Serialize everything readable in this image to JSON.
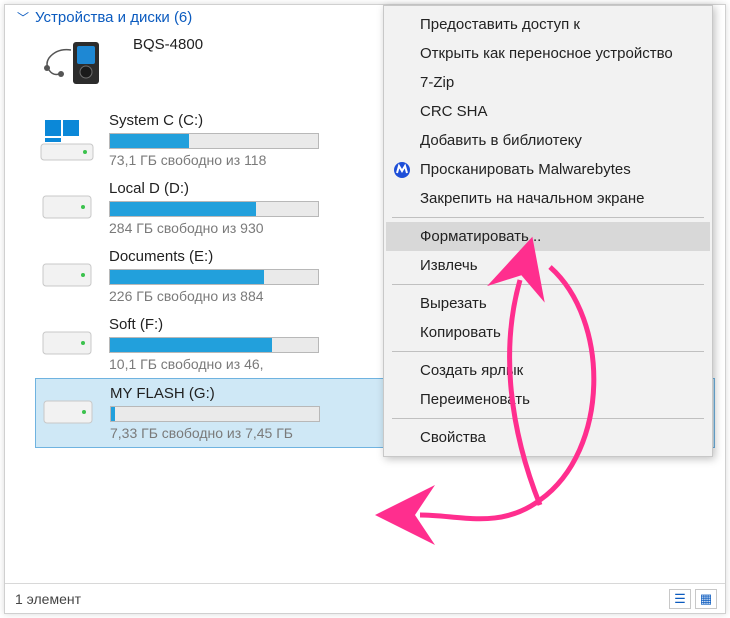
{
  "group_header": "Устройства и диски (6)",
  "device": {
    "name": "BQS-4800"
  },
  "drives": [
    {
      "label": "System C (C:)",
      "sub": "73,1 ГБ свободно из 118",
      "fill_pct": 38
    },
    {
      "label": "Local D (D:)",
      "sub": "284 ГБ свободно из 930",
      "fill_pct": 70
    },
    {
      "label": "Documents (E:)",
      "sub": "226 ГБ свободно из 884",
      "fill_pct": 74
    },
    {
      "label": "Soft (F:)",
      "sub": "10,1 ГБ свободно из 46,",
      "fill_pct": 78
    },
    {
      "label": "MY  FLASH (G:)",
      "sub": "7,33 ГБ свободно из 7,45 ГБ",
      "fill_pct": 2,
      "selected": true
    }
  ],
  "context_menu": {
    "items": [
      {
        "label": "Предоставить доступ к"
      },
      {
        "label": "Открыть как переносное устройство"
      },
      {
        "label": "7-Zip"
      },
      {
        "label": "CRC SHA"
      },
      {
        "label": "Добавить в библиотеку"
      },
      {
        "label": "Просканировать Malwarebytes",
        "icon": "malwarebytes"
      },
      {
        "label": "Закрепить на начальном экране"
      },
      {
        "type": "sep"
      },
      {
        "label": "Форматировать...",
        "hover": true
      },
      {
        "label": "Извлечь"
      },
      {
        "type": "sep"
      },
      {
        "label": "Вырезать"
      },
      {
        "label": "Копировать"
      },
      {
        "type": "sep"
      },
      {
        "label": "Создать ярлык"
      },
      {
        "label": "Переименовать"
      },
      {
        "type": "sep"
      },
      {
        "label": "Свойства"
      }
    ]
  },
  "status_bar": {
    "text": "1 элемент"
  }
}
